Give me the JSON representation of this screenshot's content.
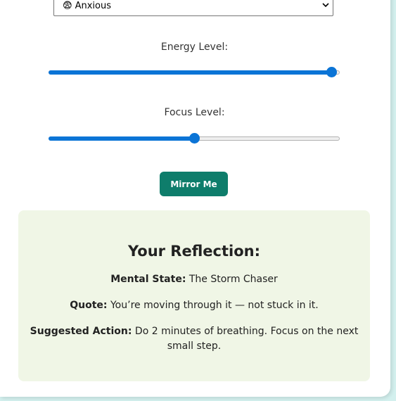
{
  "mood_select": {
    "emoji": "😨",
    "value": "Anxious"
  },
  "energy": {
    "label": "Energy Level:",
    "value_fraction": 0.97
  },
  "focus": {
    "label": "Focus Level:",
    "value_fraction": 0.5
  },
  "mirror_button": {
    "label": "Mirror Me"
  },
  "reflection": {
    "title": "Your Reflection:",
    "mental_state_label": "Mental State:",
    "mental_state_value": "The Storm Chaser",
    "quote_label": "Quote:",
    "quote_value": "You’re moving through it — not stuck in it.",
    "action_label": "Suggested Action:",
    "action_value": "Do 2 minutes of breathing. Focus on the next small step."
  },
  "colors": {
    "accent": "#0b74d6",
    "button": "#0e7d6b",
    "reflection_bg": "#f0f6e6",
    "page_bg": "#d3f0ee"
  }
}
